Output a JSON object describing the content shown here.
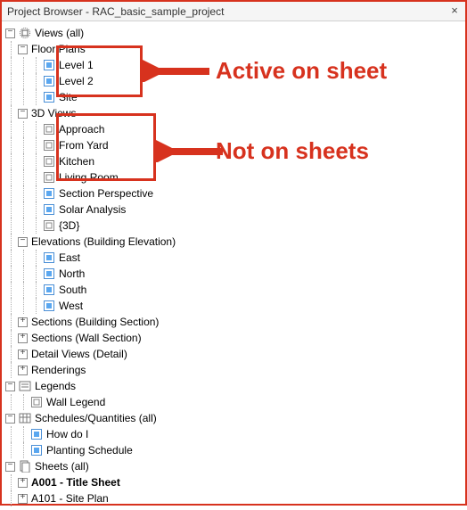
{
  "title": "Project Browser - RAC_basic_sample_project",
  "callouts": {
    "active": "Active on sheet",
    "not": "Not on sheets"
  },
  "tree": {
    "views": "Views (all)",
    "floor_plans": "Floor Plans",
    "level1": "Level 1",
    "level2": "Level 2",
    "site": "Site",
    "td_views": "3D Views",
    "approach": "Approach",
    "from_yard": "From Yard",
    "kitchen": "Kitchen",
    "living_room": "Living Room",
    "section_persp": "Section Perspective",
    "solar": "Solar Analysis",
    "brace3d": "{3D}",
    "elevations": "Elevations (Building Elevation)",
    "east": "East",
    "north": "North",
    "south": "South",
    "west": "West",
    "sections_bldg": "Sections (Building Section)",
    "sections_wall": "Sections (Wall Section)",
    "detail_views": "Detail Views (Detail)",
    "renderings": "Renderings",
    "legends": "Legends",
    "wall_legend": "Wall Legend",
    "schedules": "Schedules/Quantities (all)",
    "howdoi": "How do I",
    "planting": "Planting Schedule",
    "sheets": "Sheets (all)",
    "a001": "A001 - Title Sheet",
    "a101": "A101 - Site Plan"
  }
}
